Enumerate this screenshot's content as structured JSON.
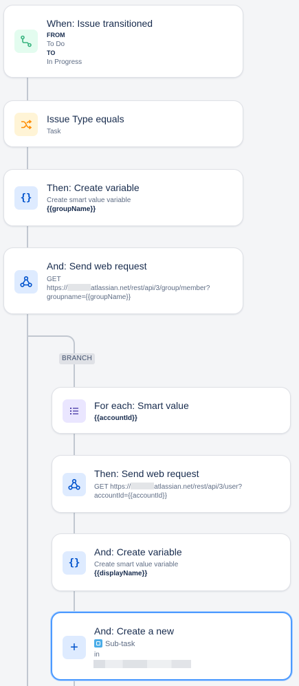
{
  "colors": {
    "trigger_icon_bg": "#e3fcef",
    "condition_icon_bg": "#fff4d6",
    "action_icon_bg": "#deebff",
    "branch_icon_bg": "#eae6ff",
    "selected_border": "#4c9aff"
  },
  "steps": [
    {
      "title": "When: Issue transitioned",
      "from_key": "FROM",
      "from_value": "To Do",
      "to_key": "TO",
      "to_value": "In Progress",
      "icon": "branch-arrow-icon"
    },
    {
      "title": "Issue Type equals",
      "line1": "Task",
      "icon": "shuffle-icon"
    },
    {
      "title": "Then: Create variable",
      "line1": "Create smart value variable",
      "line2": "{{groupName}}",
      "icon": "curly-braces-icon"
    },
    {
      "title": "And: Send web request",
      "line1": "GET",
      "line2_prefix": "https://",
      "line2_suffix": "atlassian.net/rest/api/3/group/member?",
      "line3": "groupname={{groupName}}",
      "icon": "webhook-icon"
    }
  ],
  "branch": {
    "label": "BRANCH",
    "steps": [
      {
        "title": "For each: Smart value",
        "line1": "{{accountId}}",
        "icon": "list-icon"
      },
      {
        "title": "Then: Send web request",
        "line1_prefix": "GET https://",
        "line1_suffix": "atlassian.net/rest/api/3/user?",
        "line2": "accountId={{accountId}}",
        "icon": "webhook-icon"
      },
      {
        "title": "And: Create variable",
        "line1": "Create smart value variable",
        "line2": "{{displayName}}",
        "icon": "curly-braces-icon"
      },
      {
        "title": "And: Create a new",
        "line1": "Sub-task",
        "line2": "in",
        "icon": "plus-icon"
      }
    ]
  }
}
